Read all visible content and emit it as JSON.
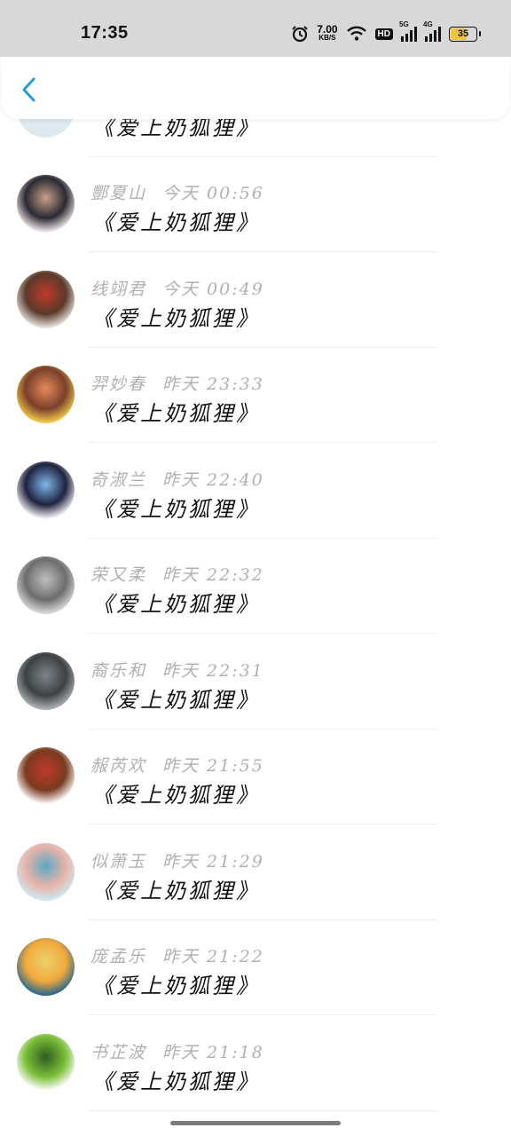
{
  "status_bar": {
    "time": "17:35",
    "net_speed_value": "7.00",
    "net_speed_unit": "KB/S",
    "hd_label": "HD",
    "signal_1_label": "5G",
    "signal_2_label": "4G",
    "battery_percent": "35",
    "battery_color": "#f3c33d"
  },
  "header": {
    "back_icon": "chevron-left-icon",
    "accent_color": "#2a9bdc"
  },
  "partial_item": {
    "title": "《爱上奶狐狸》"
  },
  "items": [
    {
      "name": "酆夏山",
      "time": "今天 00:56",
      "title": "《爱上奶狐狸》",
      "avatar_colors": [
        "#f0e6e6",
        "#2b2a33",
        "#c9a08a"
      ]
    },
    {
      "name": "线翊君",
      "time": "今天 00:49",
      "title": "《爱上奶狐狸》",
      "avatar_colors": [
        "#e7e2de",
        "#5a3a2a",
        "#c0392b"
      ]
    },
    {
      "name": "羿妙春",
      "time": "昨天 23:33",
      "title": "《爱上奶狐狸》",
      "avatar_colors": [
        "#f2c94c",
        "#7b3f2a",
        "#e58b5a"
      ]
    },
    {
      "name": "奇淑兰",
      "time": "昨天 22:40",
      "title": "《爱上奶狐狸》",
      "avatar_colors": [
        "#f6f1f7",
        "#1f2340",
        "#7fb7e8"
      ]
    },
    {
      "name": "荣又柔",
      "time": "昨天 22:32",
      "title": "《爱上奶狐狸》",
      "avatar_colors": [
        "#d9d9d9",
        "#6d6d6d",
        "#bfbfbf"
      ]
    },
    {
      "name": "裔乐和",
      "time": "昨天 22:31",
      "title": "《爱上奶狐狸》",
      "avatar_colors": [
        "#aab1b3",
        "#3d4144",
        "#7d8588"
      ]
    },
    {
      "name": "赧芮欢",
      "time": "昨天 21:55",
      "title": "《爱上奶狐狸》",
      "avatar_colors": [
        "#ffffff",
        "#7a3b1f",
        "#c0392b"
      ]
    },
    {
      "name": "似萧玉",
      "time": "昨天 21:29",
      "title": "《爱上奶狐狸》",
      "avatar_colors": [
        "#cfe6ef",
        "#e8b4a8",
        "#5aa7c7"
      ]
    },
    {
      "name": "庞孟乐",
      "time": "昨天 21:22",
      "title": "《爱上奶狐狸》",
      "avatar_colors": [
        "#2c6a8a",
        "#f3a93c",
        "#e8d26b"
      ]
    },
    {
      "name": "书芷波",
      "time": "昨天 21:18",
      "title": "《爱上奶狐狸》",
      "avatar_colors": [
        "#ffffff",
        "#7bbf3a",
        "#2f5b1f"
      ]
    }
  ]
}
